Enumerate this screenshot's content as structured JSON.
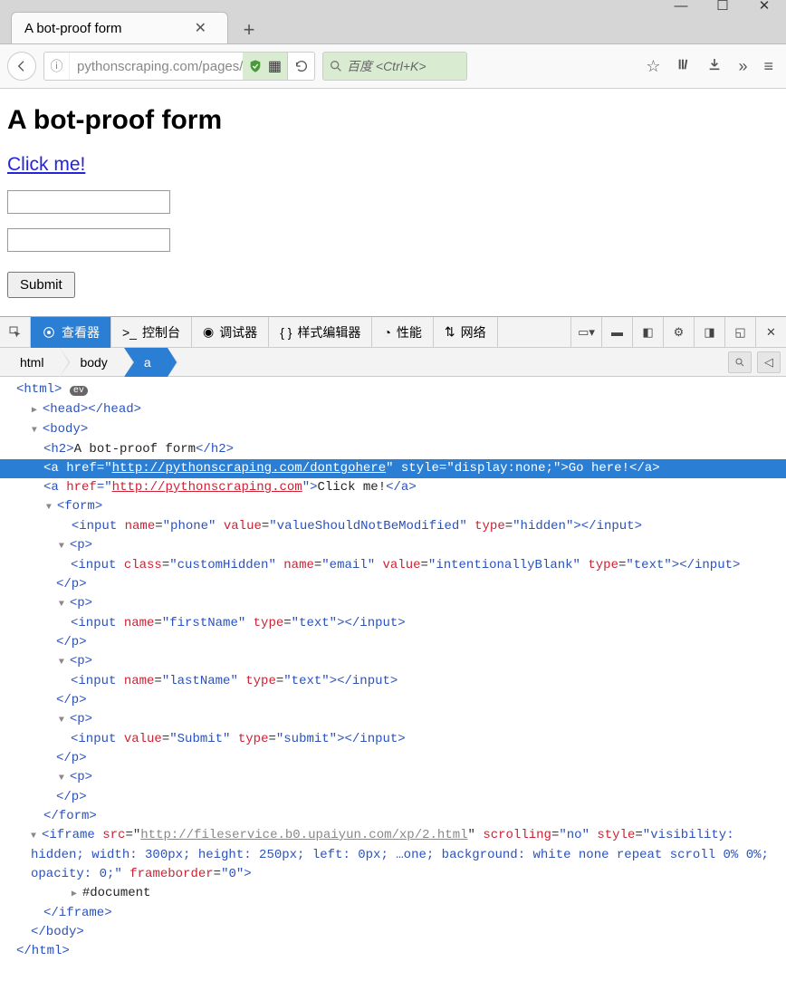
{
  "window": {
    "tab_title": "A bot-proof form",
    "url": "pythonscraping.com/pages/itsa",
    "search_placeholder": "百度 <Ctrl+K>"
  },
  "page": {
    "heading": "A bot-proof form",
    "link_text": "Click me!",
    "submit_label": "Submit"
  },
  "devtools": {
    "tabs": {
      "inspector": "查看器",
      "console": "控制台",
      "debugger": "调试器",
      "style": "样式编辑器",
      "performance": "性能",
      "network": "网络"
    },
    "breadcrumb": [
      "html",
      "body",
      "a"
    ]
  },
  "dom": {
    "html_open": "<html>",
    "head": "<head></head>",
    "body_open": "<body>",
    "h2": {
      "open": "<h2>",
      "text": "A bot-proof form",
      "close": "</h2>"
    },
    "hidden_a": {
      "open": "<a ",
      "href_attr": "href",
      "href_val": "http://pythonscraping.com/dontgohere",
      "style_attr": "style",
      "style_val": "display:none;",
      "text": "Go here!",
      "close": "</a>"
    },
    "a2": {
      "open": "<a ",
      "href_attr": "href",
      "href_val": "http://pythonscraping.com",
      "text": "Click me!",
      "close": "</a>"
    },
    "form_open": "<form>",
    "input_hidden": "<input name=\"phone\" value=\"valueShouldNotBeModified\" type=\"hidden\"></input>",
    "p_open": "<p>",
    "p_close": "</p>",
    "input_email": "<input class=\"customHidden\" name=\"email\" value=\"intentionallyBlank\" type=\"text\"></input>",
    "input_first": "<input name=\"firstName\" type=\"text\"></input>",
    "input_last": "<input name=\"lastName\" type=\"text\"></input>",
    "input_submit": "<input value=\"Submit\" type=\"submit\"></input>",
    "form_close": "</form>",
    "iframe": {
      "open": "<iframe ",
      "src_attr": "src",
      "src_val": "http://fileservice.b0.upaiyun.com/xp/2.html",
      "scrolling_attr": "scrolling",
      "scrolling_val": "no",
      "style_attr": "style",
      "style_val_1": "visibility: hidden;",
      "style_val_2": "width: 300px; height: 250px; left: 0px; …one; background: white none repeat scroll 0% 0%; opacity: 0;",
      "fb_attr": "frameborder",
      "fb_val": "0",
      "document": "#document",
      "close": "</iframe>"
    },
    "body_close": "</body>",
    "html_close": "</html>"
  }
}
